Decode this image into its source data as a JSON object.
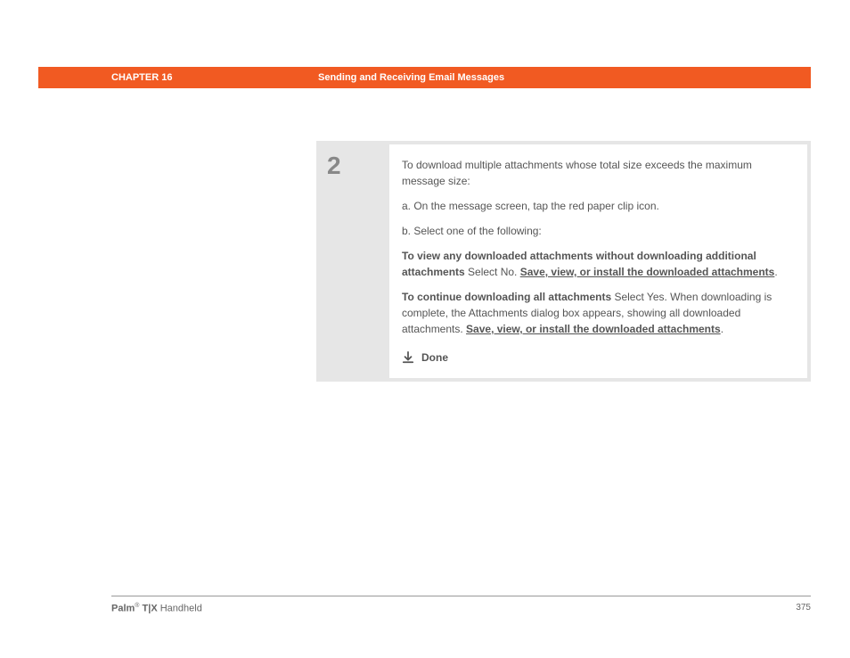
{
  "header": {
    "chapter": "CHAPTER 16",
    "title": "Sending and Receiving Email Messages"
  },
  "step": {
    "number": "2",
    "intro": "To download multiple attachments whose total size exceeds the maximum message size:",
    "items": {
      "a": "a.  On the message screen, tap the red paper clip icon.",
      "b": "b.  Select one of the following:"
    },
    "para1": {
      "bold": "To view any downloaded attachments without downloading additional attachments",
      "mid": "    Select No. ",
      "link": "Save, view, or install the downloaded attachments",
      "end": "."
    },
    "para2": {
      "bold": "To continue downloading all attachments",
      "mid": "    Select Yes. When downloading is complete, the Attachments dialog box appears, showing all downloaded attachments. ",
      "link": "Save, view, or install the downloaded attachments",
      "end": "."
    },
    "done": "Done"
  },
  "footer": {
    "brand": "Palm",
    "reg": "®",
    "model": " T|X",
    "suffix": " Handheld",
    "page": "375"
  }
}
